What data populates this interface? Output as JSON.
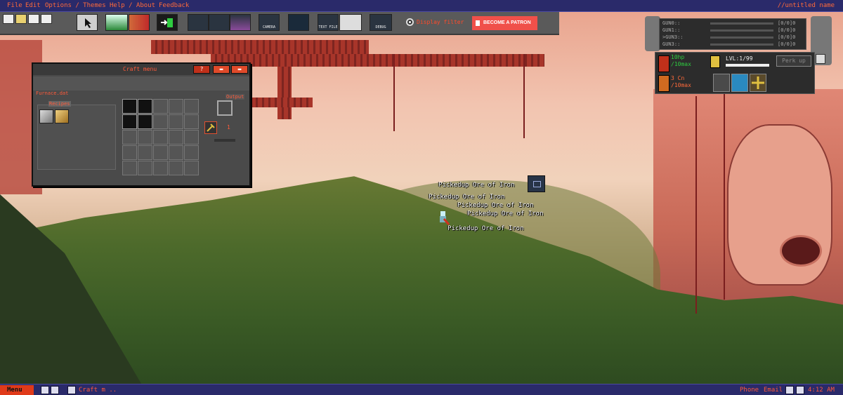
{
  "menubar": {
    "items": [
      "File",
      "Edit",
      "Options / Themes",
      "Help / About",
      "Feedback"
    ],
    "document_name": "//untitled name"
  },
  "toolbar": {
    "buttons": [
      "new-file-icon",
      "open-folder-icon",
      "save-icon",
      "save-as-icon",
      "pointer-icon",
      "terrain-icon",
      "objects-icon",
      "exit-door-icon",
      "fx-icon",
      "tree-icon",
      "water-icon",
      "camera-icon",
      "character-icon",
      "text-file-icon",
      "view-icon",
      "debug-icon"
    ],
    "camera_label": "CAMERA",
    "text_file_label": "TEXT FILE",
    "debug_label": "DEBUG",
    "display_filter_label": "Display filter",
    "patron_label": "BECOME A PATRON",
    "patron_color": "#f0504a"
  },
  "craft_menu": {
    "title": "Craft menu",
    "help_label": "?",
    "source": "Furnace.dat",
    "recipes_label": "Recipes",
    "output_label": "Output",
    "quantity": "1",
    "progress": 0.0,
    "recipes": [
      "iron-ingot-icon",
      "gold-ingot-icon"
    ]
  },
  "hud": {
    "guns": [
      {
        "name": "GUN0::",
        "ammo": "[0/0]0"
      },
      {
        "name": "GUN1::",
        "ammo": "[0/0]0"
      },
      {
        "name": ">GUN3::",
        "ammo": "[0/0]0"
      },
      {
        "name": "GUN3::",
        "ammo": "[0/0]0"
      }
    ],
    "hp": "10hp",
    "hp_max": "/10max",
    "energy": "3 Cn",
    "energy_max": "/10max",
    "level": "LVL:1/99",
    "perk_label": "Perk up"
  },
  "pickups": [
    "Pickedup Ore of Iron",
    "Pickedup Ore of Iron",
    "Pickedup Ore of Iron",
    "Pickedup Ore of Iron",
    "Pickedup Ore of Iron"
  ],
  "taskbar": {
    "menu_label": "Menu",
    "task_label": "Craft m ..",
    "phone_label": "Phone",
    "email_label": "Email",
    "clock": "4:12 AM"
  }
}
